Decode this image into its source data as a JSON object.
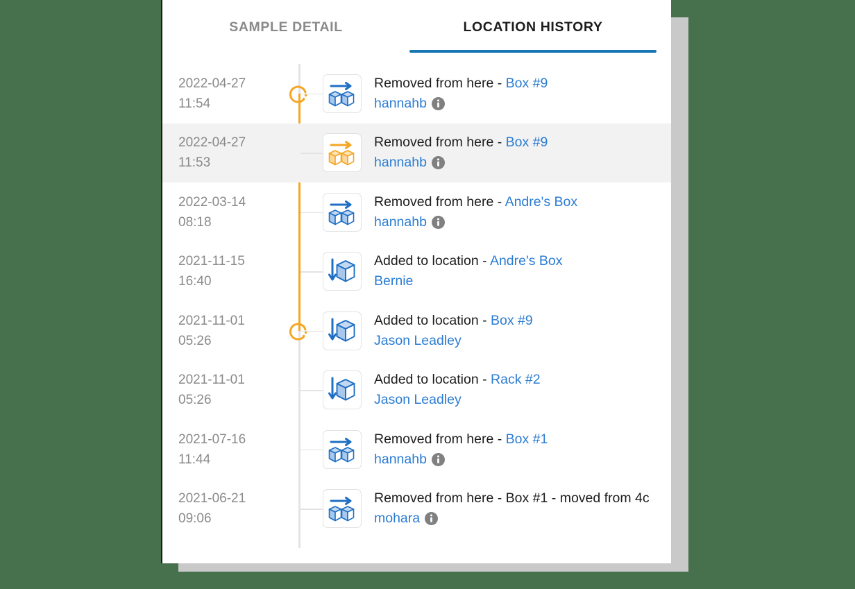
{
  "theme": {
    "background": "#47704c",
    "card_background": "#ffffff",
    "accent_blue": "#1976b5",
    "link_blue": "#2b7cd3",
    "timeline_orange": "#f5a623",
    "muted_text": "#8a8a8a",
    "row_highlight": "#f2f2f2"
  },
  "tabs": [
    {
      "id": "sample-detail",
      "label": "SAMPLE DETAIL",
      "active": false
    },
    {
      "id": "location-history",
      "label": "LOCATION HISTORY",
      "active": true
    }
  ],
  "timeline": {
    "entries": [
      {
        "date": "2022-04-27",
        "time": "11:54",
        "icon": "removed-from-here-icon",
        "icon_color": "blue",
        "action": "Removed from here - ",
        "location": "Box #9",
        "location_is_link": true,
        "user": "hannahb",
        "user_is_link": true,
        "has_info": true,
        "has_marker": true,
        "highlighted": false
      },
      {
        "date": "2022-04-27",
        "time": "11:53",
        "icon": "removed-from-here-icon",
        "icon_color": "orange",
        "action": "Removed from here - ",
        "location": "Box #9",
        "location_is_link": true,
        "user": "hannahb",
        "user_is_link": true,
        "has_info": true,
        "has_marker": false,
        "highlighted": true
      },
      {
        "date": "2022-03-14",
        "time": "08:18",
        "icon": "removed-from-here-icon",
        "icon_color": "blue",
        "action": "Removed from here - ",
        "location": "Andre's Box",
        "location_is_link": true,
        "user": "hannahb",
        "user_is_link": true,
        "has_info": true,
        "has_marker": false,
        "highlighted": false
      },
      {
        "date": "2021-11-15",
        "time": "16:40",
        "icon": "added-to-location-icon",
        "icon_color": "blue",
        "action": "Added to location - ",
        "location": "Andre's Box",
        "location_is_link": true,
        "user": "Bernie",
        "user_is_link": true,
        "has_info": false,
        "has_marker": false,
        "highlighted": false
      },
      {
        "date": "2021-11-01",
        "time": "05:26",
        "icon": "added-to-location-icon",
        "icon_color": "blue",
        "action": "Added to location - ",
        "location": "Box #9",
        "location_is_link": true,
        "user": "Jason Leadley",
        "user_is_link": true,
        "has_info": false,
        "has_marker": true,
        "highlighted": false
      },
      {
        "date": "2021-11-01",
        "time": "05:26",
        "icon": "added-to-location-icon",
        "icon_color": "blue",
        "action": "Added to location - ",
        "location": "Rack #2",
        "location_is_link": true,
        "user": "Jason Leadley",
        "user_is_link": true,
        "has_info": false,
        "has_marker": false,
        "highlighted": false
      },
      {
        "date": "2021-07-16",
        "time": "11:44",
        "icon": "removed-from-here-icon",
        "icon_color": "blue",
        "action": "Removed from here - ",
        "location": "Box #1",
        "location_is_link": true,
        "user": "hannahb",
        "user_is_link": true,
        "has_info": true,
        "has_marker": false,
        "highlighted": false
      },
      {
        "date": "2021-06-21",
        "time": "09:06",
        "icon": "removed-from-here-icon",
        "icon_color": "blue",
        "action": "Removed from here - ",
        "location": "Box #1 - moved from 4c",
        "location_is_link": false,
        "user": "mohara",
        "user_is_link": true,
        "has_info": true,
        "has_marker": false,
        "highlighted": false
      }
    ]
  }
}
